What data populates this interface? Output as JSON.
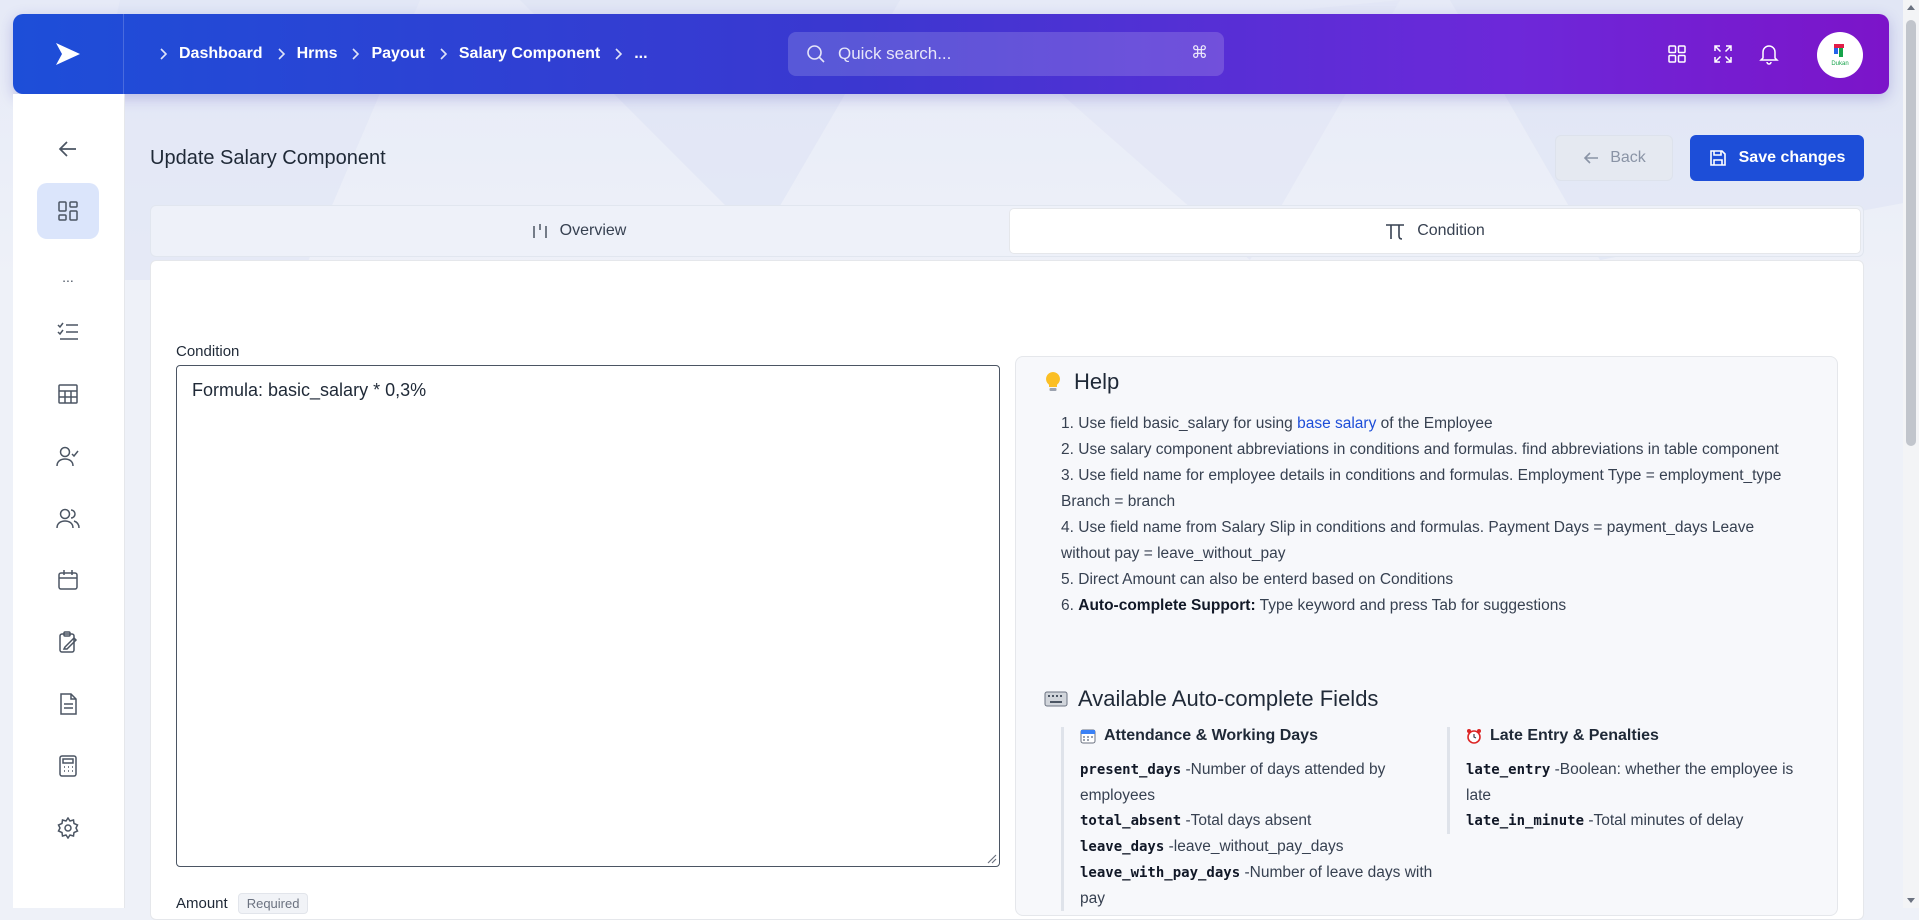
{
  "topbar": {
    "breadcrumb": [
      "Dashboard",
      "Hrms",
      "Payout",
      "Salary Component",
      "..."
    ],
    "search_placeholder": "Quick search...",
    "search_shortcut": "⌘",
    "avatar_text": "Dukan"
  },
  "sidebar": {
    "items": [
      "back-arrow-icon",
      "dashboard-icon",
      "more",
      "checklist-icon",
      "table-icon",
      "user-check-icon",
      "users-icon",
      "calendar-icon",
      "clipboard-edit-icon",
      "document-icon",
      "calculator-icon",
      "settings-icon"
    ],
    "dots": "..."
  },
  "page": {
    "title": "Update Salary Component",
    "back_label": "Back",
    "save_label": "Save changes"
  },
  "tabs": [
    {
      "label": "Overview",
      "active": false
    },
    {
      "label": "Condition",
      "active": true
    }
  ],
  "form": {
    "condition_label": "Condition",
    "condition_value": "Formula: basic_salary * 0,3%",
    "amount_label": "Amount",
    "amount_badge": "Required"
  },
  "help": {
    "title": "Help",
    "items": [
      {
        "num": "1.",
        "pre": "Use field basic_salary for using ",
        "link": "base salary",
        "post": " of the Employee"
      },
      {
        "num": "2.",
        "text": "Use salary component abbreviations in conditions and formulas. find abbreviations in table component"
      },
      {
        "num": "3.",
        "text": "Use field name for employee details in conditions and formulas. Employment Type = employment_type Branch = branch"
      },
      {
        "num": "4.",
        "text": "Use field name from Salary Slip in conditions and formulas. Payment Days = payment_days Leave without pay = leave_without_pay"
      },
      {
        "num": "5.",
        "text": "Direct Amount can also be enterd based on Conditions"
      },
      {
        "num": "6.",
        "bold": "Auto-complete Support:",
        "text": " Type keyword and press Tab for suggestions"
      }
    ],
    "auto_title": "Available Auto-complete Fields",
    "col1_title": "Attendance & Working Days",
    "col1_fields": [
      {
        "code": "present_days",
        "desc": " -Number of days attended by employees"
      },
      {
        "code": "total_absent",
        "desc": " -Total days absent"
      },
      {
        "code": "leave_days",
        "desc": " -leave_without_pay_days"
      },
      {
        "code": "leave_with_pay_days",
        "desc": " -Number of leave days with pay"
      }
    ],
    "col2_title": "Late Entry & Penalties",
    "col2_fields": [
      {
        "code": "late_entry",
        "desc": " -Boolean: whether the employee is late"
      },
      {
        "code": "late_in_minute",
        "desc": " -Total minutes of delay"
      }
    ]
  },
  "colors": {
    "primary": "#1d4ed8",
    "accent_gradient_end": "#7c14c9"
  }
}
